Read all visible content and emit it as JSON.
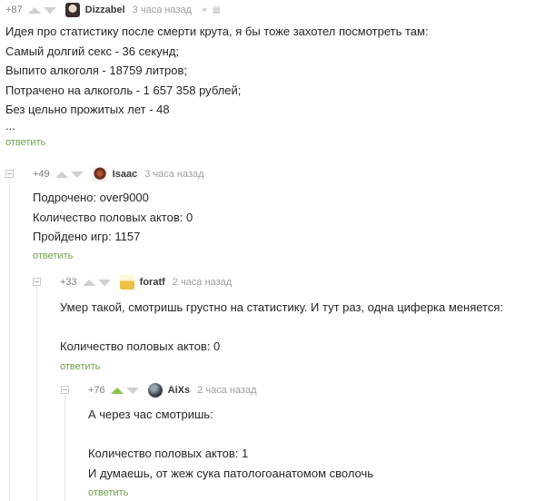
{
  "comments": [
    {
      "rating": "+87",
      "author": "Dizzabel",
      "time": "3 часа назад",
      "lines": [
        "Идея про статистику после смерти крута, я бы тоже захотел посмотреть там:",
        "Самый долгий секс - 36 секунд;",
        "Выпито алкоголя - 18759 литров;",
        "Потрачено на алкоголь - 1 657 358 рублей;",
        "Без цельно прожитых лет - 48",
        "..."
      ],
      "reply": "ответить"
    },
    {
      "rating": "+49",
      "author": "Isaac",
      "time": "3 часа назад",
      "lines": [
        "Подрочено: over9000",
        "Количество половых актов: 0",
        "Пройдено игр: 1157"
      ],
      "reply": "ответить"
    },
    {
      "rating": "+33",
      "author": "foratf",
      "time": "2 часа назад",
      "lines": [
        "Умер такой, смотришь грустно на статистику. И тут раз, одна циферка меняется:",
        "",
        "Количество половых актов: 0"
      ],
      "reply": "ответить"
    },
    {
      "rating": "+76",
      "author": "AiXs",
      "time": "2 часа назад",
      "lines": [
        "А через час смотришь:",
        "",
        "Количество половых актов: 1",
        "И думаешь, от жеж сука патологоанатомом сволочь"
      ],
      "reply": "ответить"
    }
  ],
  "colors": {
    "reply_link": "#6ea04a",
    "upvote_active": "#8bc34a",
    "arrow_inactive": "#cfcfcf",
    "tree_line": "#e6e6e6"
  }
}
